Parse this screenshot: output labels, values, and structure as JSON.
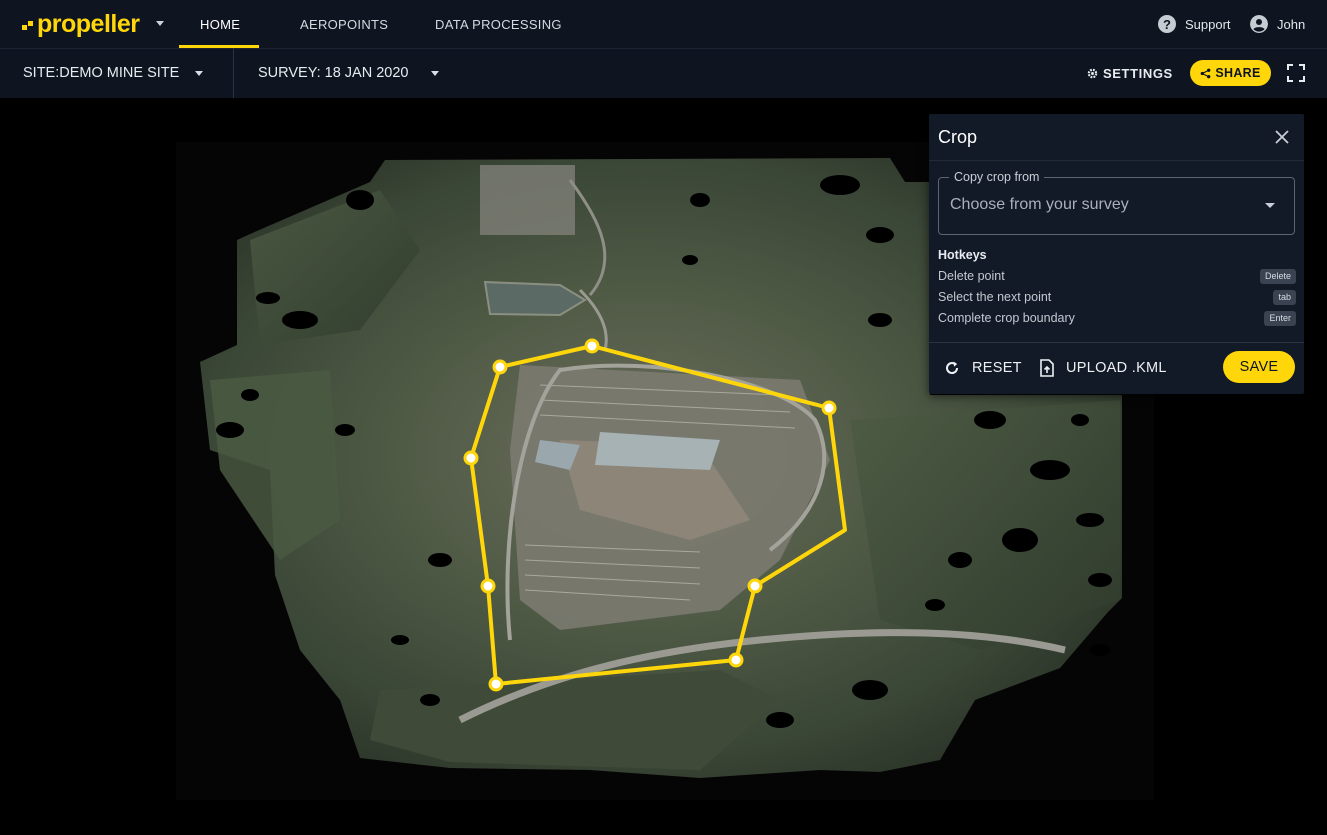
{
  "app": {
    "brand": "propeller",
    "nav_tabs": [
      {
        "label": "HOME",
        "active": true
      },
      {
        "label": "AEROPOINTS",
        "active": false
      },
      {
        "label": "DATA PROCESSING",
        "active": false
      }
    ],
    "support_label": "Support",
    "user_name": "John"
  },
  "subbar": {
    "site_label": "SITE:DEMO MINE SITE",
    "survey_label": "SURVEY: 18 JAN 2020",
    "settings_label": "SETTINGS",
    "share_label": "SHARE"
  },
  "crop_panel": {
    "title": "Crop",
    "copy_from_label": "Copy crop from",
    "copy_from_placeholder": "Choose from your survey",
    "hotkeys_title": "Hotkeys",
    "hotkeys": [
      {
        "label": "Delete point",
        "key": "Delete"
      },
      {
        "label": "Select the next point",
        "key": "tab"
      },
      {
        "label": "Complete crop boundary",
        "key": "Enter"
      }
    ],
    "reset_label": "RESET",
    "upload_label": "UPLOAD .KML",
    "save_label": "SAVE"
  },
  "colors": {
    "accent": "#ffd60a",
    "nav_bg": "#0e1420",
    "panel_bg": "#121a27"
  },
  "icons": [
    "caret-down-icon",
    "help-circle-icon",
    "account-circle-icon",
    "gear-icon",
    "share-icon",
    "fullscreen-icon",
    "close-icon",
    "refresh-icon",
    "file-upload-icon"
  ]
}
